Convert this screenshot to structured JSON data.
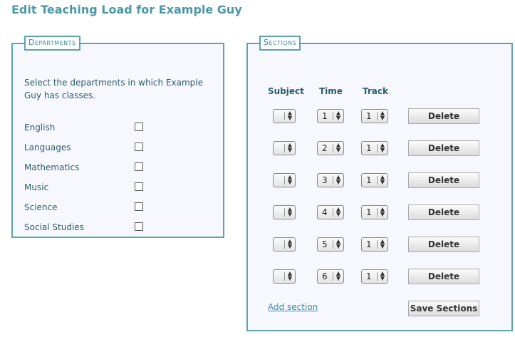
{
  "page": {
    "title": "Edit Teaching Load for Example Guy"
  },
  "departments": {
    "legend": "Departments",
    "intro": "Select the departments in which Example Guy has classes.",
    "items": [
      {
        "label": "English",
        "checked": false
      },
      {
        "label": "Languages",
        "checked": false
      },
      {
        "label": "Mathematics",
        "checked": false
      },
      {
        "label": "Music",
        "checked": false
      },
      {
        "label": "Science",
        "checked": false
      },
      {
        "label": "Social Studies",
        "checked": false
      }
    ]
  },
  "sections": {
    "legend": "Sections",
    "headers": {
      "subject": "Subject",
      "time": "Time",
      "track": "Track"
    },
    "rows": [
      {
        "subject": "",
        "time": "1",
        "track": "1",
        "delete_label": "Delete"
      },
      {
        "subject": "",
        "time": "2",
        "track": "1",
        "delete_label": "Delete"
      },
      {
        "subject": "",
        "time": "3",
        "track": "1",
        "delete_label": "Delete"
      },
      {
        "subject": "",
        "time": "4",
        "track": "1",
        "delete_label": "Delete"
      },
      {
        "subject": "",
        "time": "5",
        "track": "1",
        "delete_label": "Delete"
      },
      {
        "subject": "",
        "time": "6",
        "track": "1",
        "delete_label": "Delete"
      }
    ],
    "add_label": "Add section",
    "save_label": "Save Sections"
  }
}
